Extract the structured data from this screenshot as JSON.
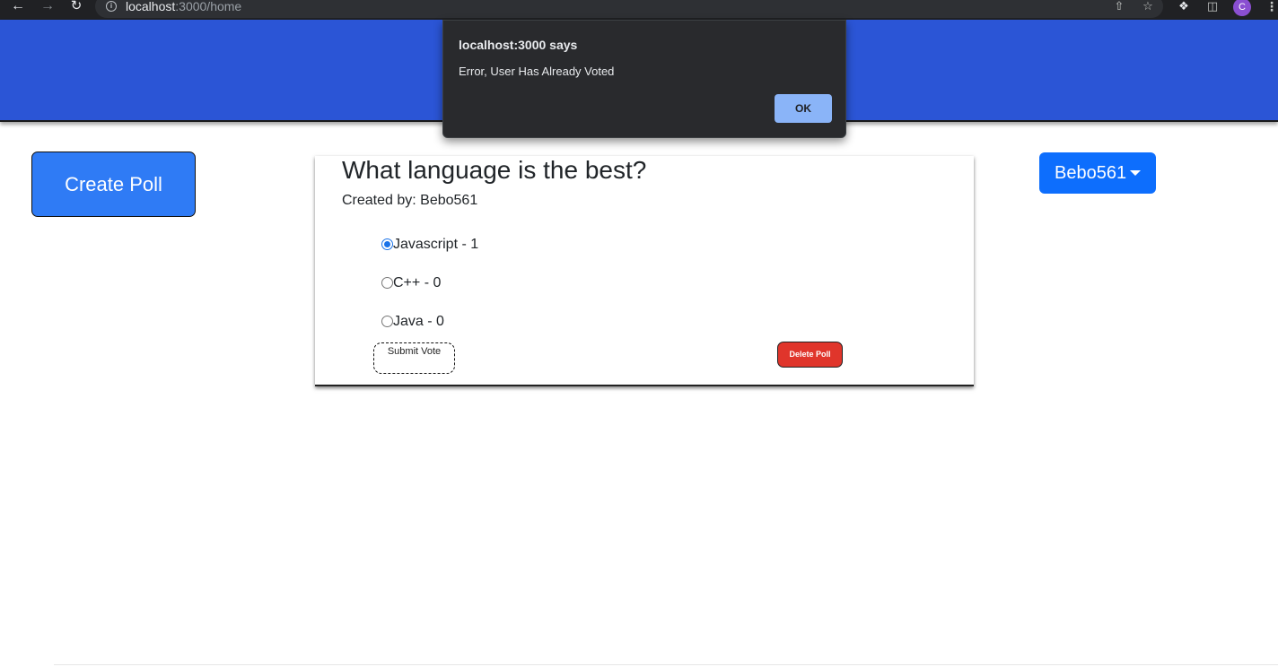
{
  "browser": {
    "url_host": "localhost",
    "url_path": ":3000/home",
    "profile_initial": "C",
    "icons": [
      "back-arrow-icon",
      "forward-arrow-icon",
      "reload-icon",
      "info-icon",
      "share-icon",
      "star-icon",
      "extensions-icon",
      "side-panel-icon",
      "kebab-menu-icon"
    ]
  },
  "sidebar": {
    "create_poll_label": "Create Poll"
  },
  "user_menu": {
    "username": "Bebo561"
  },
  "poll": {
    "question": "What language is the best?",
    "created_by": "Created by: Bebo561",
    "options": [
      {
        "label": "Javascript - 1",
        "selected": true
      },
      {
        "label": "C++ - 0",
        "selected": false
      },
      {
        "label": "Java - 0",
        "selected": false
      }
    ],
    "submit_label": "Submit Vote",
    "delete_label": "Delete Poll"
  },
  "alert": {
    "title": "localhost:3000 says",
    "message": "Error, User Has Already Voted",
    "ok_label": "OK"
  },
  "colors": {
    "header_blue": "#2b55d6",
    "create_poll_blue": "#2f7bf5",
    "dropdown_blue": "#0d6efd",
    "delete_red": "#e0352b",
    "alert_bg": "#292a2d",
    "alert_ok": "#8ab4f8"
  }
}
